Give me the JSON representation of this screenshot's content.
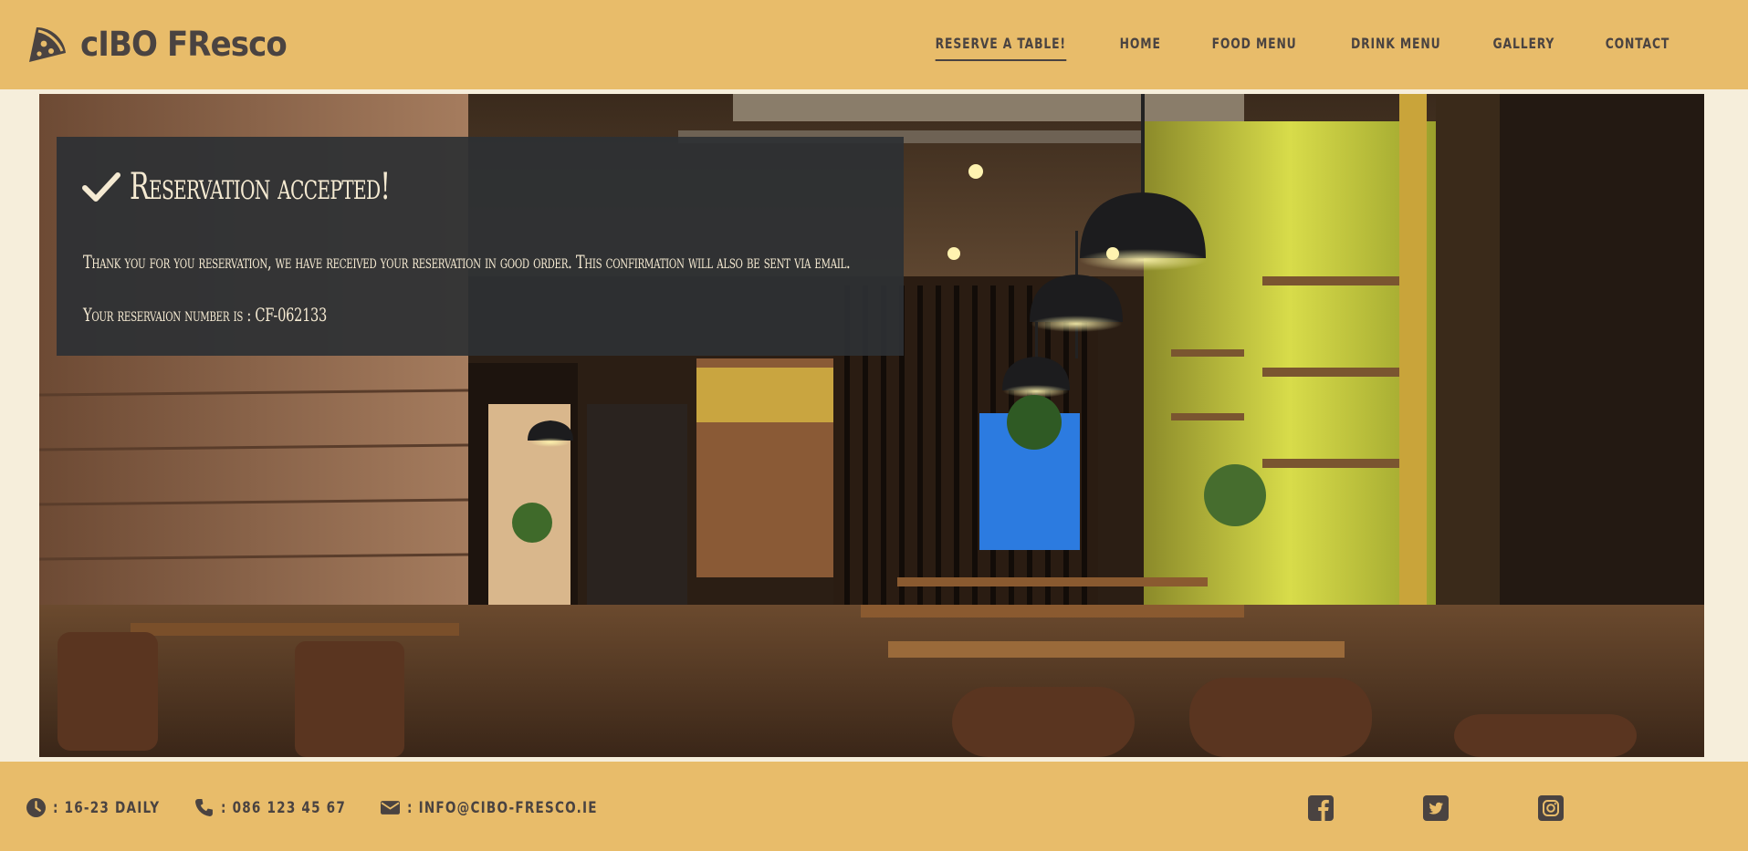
{
  "brand": {
    "name": "cIBO FResco",
    "icon": "pizza-slice-icon"
  },
  "nav": {
    "items": [
      {
        "label": "RESERVE A TABLE!",
        "active": true
      },
      {
        "label": "HOME"
      },
      {
        "label": "FOOD MENU"
      },
      {
        "label": "DRINK MENU"
      },
      {
        "label": "GALLERY"
      },
      {
        "label": "CONTACT"
      }
    ]
  },
  "hero": {
    "image": "restaurant-interior-photo"
  },
  "confirmation": {
    "icon": "check-icon",
    "title": "Reservation accepted!",
    "message": "Thank you for you reservation, we have received your reservation in good order. This confirmation will also be sent via email.",
    "reservation_text": "Your reservaion number is : CF-062133"
  },
  "footer": {
    "hours": {
      "icon": "clock-icon",
      "text": ": 16-23 DAILY"
    },
    "phone": {
      "icon": "phone-icon",
      "text": ": 086 123 45 67"
    },
    "email": {
      "icon": "envelope-icon",
      "text": ": INFO@CIBO-FRESCO.IE"
    },
    "social": [
      "facebook-icon",
      "twitter-icon",
      "instagram-icon"
    ]
  },
  "colors": {
    "header_bg": "#e8bc6a",
    "page_bg": "#f6eedb",
    "text_dark": "#4a4341",
    "panel_bg": "#2d3034",
    "panel_text": "#f5ead2"
  }
}
